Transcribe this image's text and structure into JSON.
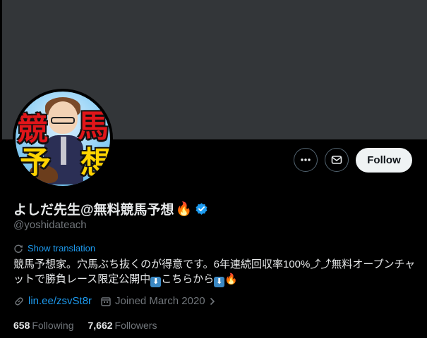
{
  "profile": {
    "display_name": "よしだ先生@無料競馬予想",
    "name_emoji": "🔥",
    "handle": "@yoshidateach",
    "avatar_text": [
      "競",
      "馬",
      "予",
      "想"
    ],
    "verified": true
  },
  "actions": {
    "more_icon": "more-icon",
    "message_icon": "message-icon",
    "follow_label": "Follow"
  },
  "translate": {
    "label": "Show translation"
  },
  "bio": {
    "line1": "競馬予想家。穴馬ぶち抜くのが得意です。6年連続回収率100%⤴⤴無料オープンチャ",
    "line2_a": "ットで勝負レース限定公開中",
    "line2_b": "こちらから",
    "arrow_glyph": "⬇",
    "fire": "🔥"
  },
  "meta": {
    "link": "lin.ee/zsvSt8r",
    "joined": "Joined March 2020"
  },
  "stats": {
    "following_count": "658",
    "following_label": "Following",
    "followers_count": "7,662",
    "followers_label": "Followers"
  },
  "colors": {
    "background": "#000000",
    "banner": "#333639",
    "accent": "#1d9bf0",
    "muted": "#71767b",
    "text": "#e7e9ea"
  }
}
